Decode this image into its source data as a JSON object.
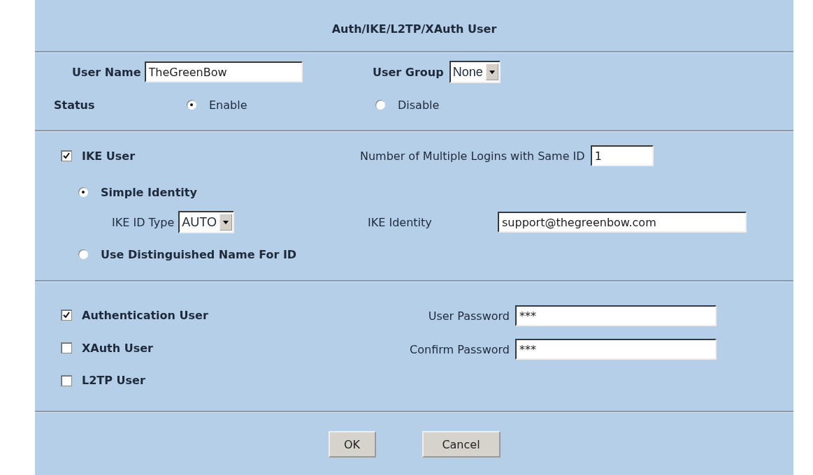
{
  "title": "Auth/IKE/L2TP/XAuth User",
  "user_name": {
    "label": "User Name",
    "value": "TheGreenBow"
  },
  "user_group": {
    "label": "User Group",
    "value": "None"
  },
  "status": {
    "label": "Status",
    "options": [
      {
        "label": "Enable",
        "selected": true
      },
      {
        "label": "Disable",
        "selected": false
      }
    ]
  },
  "ike_user": {
    "label": "IKE User",
    "checked": true
  },
  "multiple_logins": {
    "label": "Number of Multiple Logins with Same ID",
    "value": "1"
  },
  "simple_identity": {
    "label": "Simple Identity",
    "selected": true
  },
  "ike_id_type": {
    "label": "IKE ID Type",
    "value": "AUTO"
  },
  "ike_identity": {
    "label": "IKE Identity",
    "value": "support@thegreenbow.com"
  },
  "distinguished_name": {
    "label": "Use Distinguished Name For ID",
    "selected": false
  },
  "user_types": [
    {
      "label": "Authentication User",
      "checked": true
    },
    {
      "label": "XAuth User",
      "checked": false
    },
    {
      "label": "L2TP User",
      "checked": false
    }
  ],
  "passwords": [
    {
      "label": "User Password",
      "value": "***"
    },
    {
      "label": "Confirm Password",
      "value": "***"
    }
  ],
  "buttons": [
    "OK",
    "Cancel"
  ]
}
